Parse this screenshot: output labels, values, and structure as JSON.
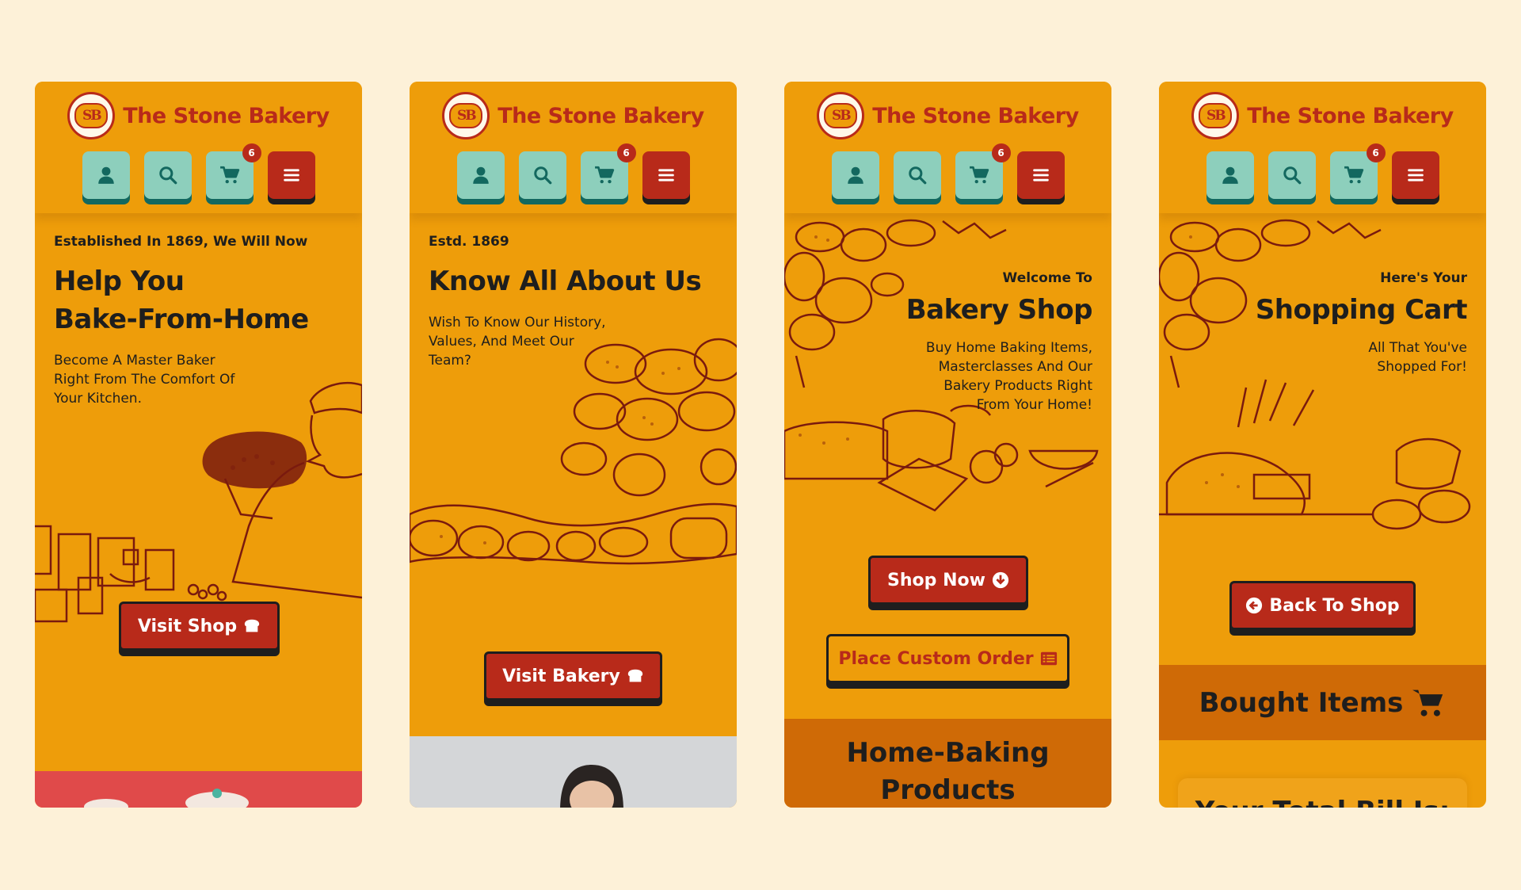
{
  "brand": {
    "name": "The Stone Bakery",
    "logo_text": "SB"
  },
  "icons": {
    "user": "user-icon",
    "search": "search-icon",
    "cart": "cart-icon",
    "menu": "menu-icon"
  },
  "cart_badge": "6",
  "colors": {
    "background": "#fdf1d8",
    "orange": "#ee9d0a",
    "dark_orange": "#cf6a06",
    "red": "#b82a1a",
    "teal": "#8dcfbc",
    "ink": "#1e1e1e"
  },
  "screens": [
    {
      "kicker": "Established In 1869, We Will Now",
      "title_line1": "Help You",
      "title_line2": "Bake-From-Home",
      "para_line1": "Become A Master Baker",
      "para_line2": "Right From The Comfort Of",
      "para_line3": "Your Kitchen.",
      "cta": "Visit Shop"
    },
    {
      "kicker": "Estd. 1869",
      "title": "Know All About Us",
      "para_line1": "Wish To Know Our History,",
      "para_line2": "Values, And Meet Our",
      "para_line3": "Team?",
      "cta": "Visit Bakery"
    },
    {
      "kicker": "Welcome To",
      "title": "Bakery Shop",
      "para_line1": "Buy Home Baking Items,",
      "para_line2": "Masterclasses And Our",
      "para_line3": "Bakery Products Right",
      "para_line4": "From Your Home!",
      "cta": "Shop Now",
      "cta2": "Place Custom Order",
      "section_line1": "Home-Baking",
      "section_line2": "Products"
    },
    {
      "kicker": "Here's Your",
      "title": "Shopping Cart",
      "para_line1": "All That You've",
      "para_line2": "Shopped For!",
      "cta": "Back To Shop",
      "section": "Bought Items",
      "total_label": "Your Total Bill Is:"
    }
  ]
}
